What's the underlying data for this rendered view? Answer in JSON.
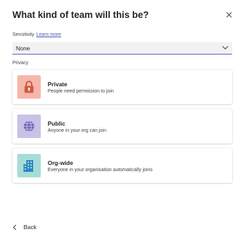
{
  "dialog": {
    "title": "What kind of team will this be?",
    "close_icon": "close-icon"
  },
  "sensitivity": {
    "label": "Sensitivity",
    "learn_more": "Learn more",
    "selected": "None",
    "chevron_icon": "chevron-down-icon"
  },
  "privacy": {
    "label": "Privacy",
    "options": [
      {
        "title": "Private",
        "description": "People need permission to join",
        "icon": "lock-icon",
        "tile_color": "#f6b7ab",
        "icon_color": "#d05a43"
      },
      {
        "title": "Public",
        "description": "Anyone in your org can join",
        "icon": "globe-icon",
        "tile_color": "#c7c2e6",
        "icon_color": "#6b62b8"
      },
      {
        "title": "Org-wide",
        "description": "Everyone in your organisation automatically joins",
        "icon": "building-icon",
        "tile_color": "#a7ddd6",
        "icon_color": "#2f87c4"
      }
    ]
  },
  "footer": {
    "back_label": "Back",
    "back_icon": "chevron-left-icon"
  },
  "colors": {
    "accent": "#5b5fc7",
    "link": "#4f52b2"
  }
}
